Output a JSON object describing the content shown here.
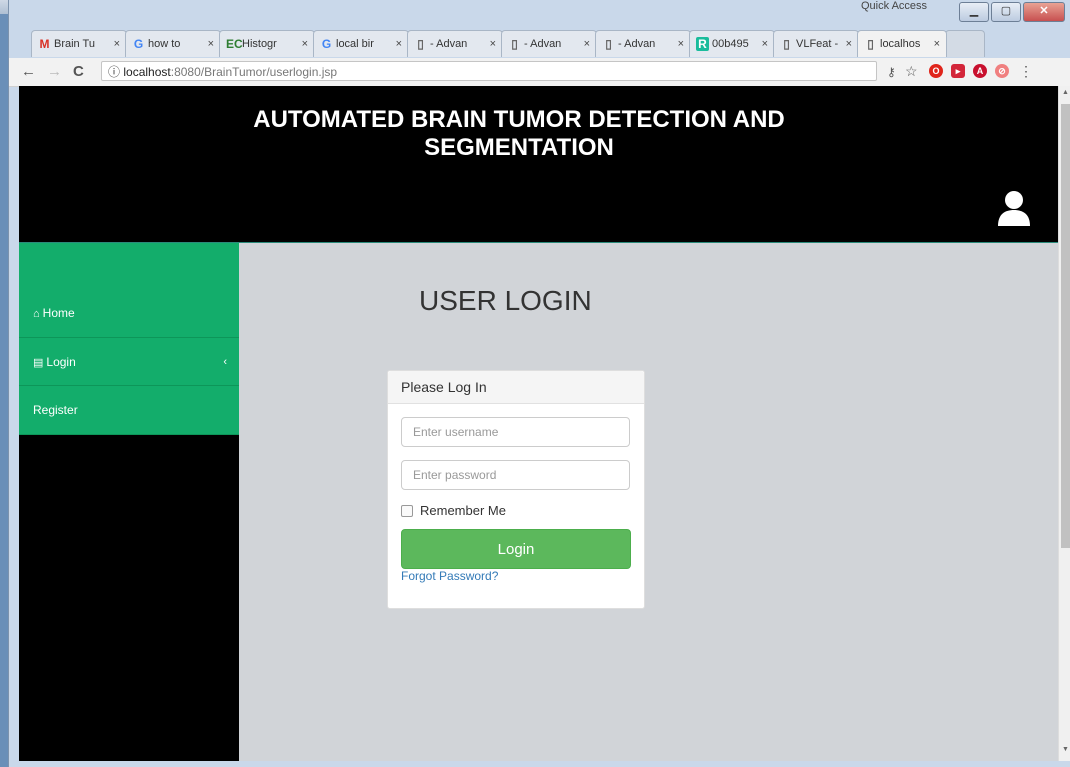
{
  "browser": {
    "tabs": [
      {
        "fav": "M",
        "label": "Brain Tu",
        "fav_color": "#d93025"
      },
      {
        "fav": "G",
        "label": "how to",
        "fav_color": "#4285f4"
      },
      {
        "fav": "EC",
        "label": "Histogr",
        "fav_color": "#2e7d32"
      },
      {
        "fav": "G",
        "label": "local bir",
        "fav_color": "#4285f4"
      },
      {
        "fav": "▯",
        "label": "- Advan",
        "fav_color": "#666666"
      },
      {
        "fav": "▯",
        "label": "- Advan",
        "fav_color": "#666666"
      },
      {
        "fav": "▯",
        "label": "- Advan",
        "fav_color": "#666666"
      },
      {
        "fav": "R",
        "label": "00b495",
        "fav_color": "#1abc9c"
      },
      {
        "fav": "▯",
        "label": "VLFeat -",
        "fav_color": "#666666"
      },
      {
        "fav": "▯",
        "label": "localhos",
        "fav_color": "#666666"
      }
    ],
    "close_glyph": "×",
    "quick_access": "Quick Access",
    "url_host": "localhost",
    "url_path": ":8080/BrainTumor/userlogin.jsp",
    "info_glyph": "ⓘ",
    "back": "←",
    "forward": "→",
    "reload": "C",
    "star": "☆"
  },
  "header": {
    "title_line1": "AUTOMATED BRAIN TUMOR DETECTION AND",
    "title_line2": "SEGMENTATION"
  },
  "sidebar": {
    "items": [
      {
        "icon": "home-icon",
        "glyph": "⌂",
        "label": "Home"
      },
      {
        "icon": "chart-icon",
        "glyph": "▤",
        "label": "Login"
      },
      {
        "icon": "",
        "glyph": "",
        "label": "Register"
      }
    ],
    "chevron": "‹"
  },
  "main": {
    "heading": "USER LOGIN",
    "panel_title": "Please Log In",
    "username_placeholder": "Enter username",
    "password_placeholder": "Enter password",
    "remember_label": "Remember Me",
    "login_label": "Login",
    "forgot_label": "Forgot Password?"
  },
  "colors": {
    "header_bg": "#000000",
    "sidebar_green": "#13ad6b",
    "login_green": "#5cb85c",
    "link_blue": "#337ab7"
  }
}
